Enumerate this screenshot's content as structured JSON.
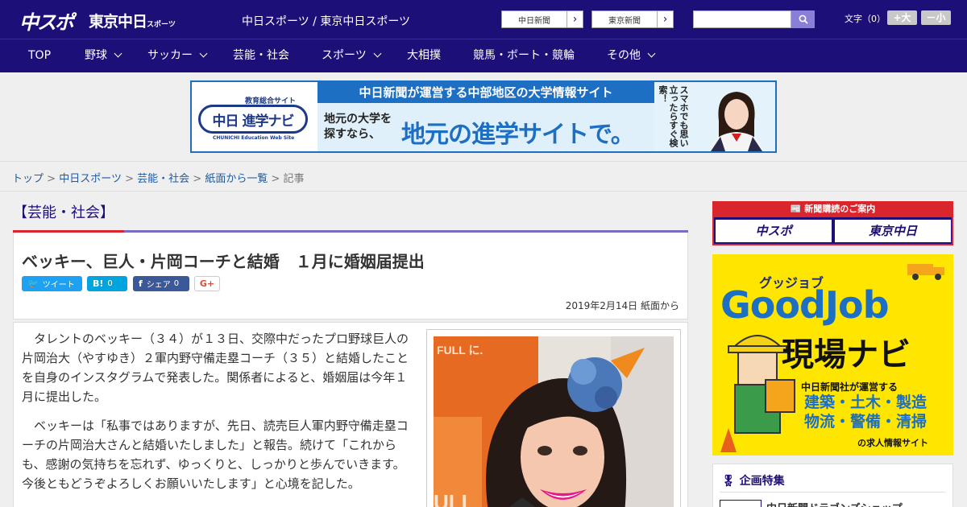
{
  "header": {
    "logo_chuspo": "中スポ",
    "logo_tokyo": "東京中日",
    "logo_tokyo_sub": "スポーツ",
    "brand_text": "中日スポーツ / 東京中日スポーツ",
    "link_chunichi": "中日新聞",
    "link_tokyo": "東京新聞",
    "search_placeholder": "",
    "fontsize_label": "文字（0）",
    "fontsize_plus": "+大",
    "fontsize_minus": "－小"
  },
  "nav": {
    "items": [
      {
        "label": "TOP"
      },
      {
        "label": "野球"
      },
      {
        "label": "サッカー"
      },
      {
        "label": "芸能・社会"
      },
      {
        "label": "スポーツ"
      },
      {
        "label": "大相撲"
      },
      {
        "label": "競馬・ボート・競輪"
      },
      {
        "label": "その他"
      }
    ]
  },
  "banner": {
    "left_sub": "教育総合サイト",
    "left_logo": "中日 進学ナビ",
    "left_en": "CHUNICHI Education Web Site",
    "top": "中日新聞が運営する中部地区の大学情報サイト",
    "mid_small_1": "地元の大学を",
    "mid_small_2": "探すなら、",
    "mid_big": "地元の進学サイトで。",
    "right_text": "スマホでも思い立ったらすぐ検索！"
  },
  "breadcrumb": {
    "items": [
      "トップ",
      "中日スポーツ",
      "芸能・社会",
      "紙面から一覧"
    ],
    "current": "記事",
    "separator": ">"
  },
  "article": {
    "category": "【芸能・社会】",
    "headline": "ベッキー、巨人・片岡コーチと結婚　１月に婚姻届提出",
    "share": {
      "tweet": "ツイート",
      "hatena_icon": "B!",
      "hatena_count": "0",
      "fb_label": "シェア",
      "fb_count": "0",
      "gplus": "G+"
    },
    "dateline": "2019年2月14日 紙面から",
    "paragraphs": [
      "タレントのベッキー（３４）が１３日、交際中だったプロ野球巨人の片岡治大（やすゆき）２軍内野守備走塁コーチ（３５）と結婚したことを自身のインスタグラムで発表した。関係者によると、婚姻届は今年１月に提出した。",
      "ベッキーは「私事ではありますが、先日、読売巨人軍内野守備走塁コーチの片岡治大さんと結婚いたしました」と報告。続けて「これからも、感謝の気持ちを忘れず、ゆっくりと、しっかりと歩んでいきます。今後ともどうぞよろしくお願いいたします」と心境を記した。"
    ],
    "photo_backdrop_text": "FULL に.",
    "photo_backdrop_text2": "ULL"
  },
  "sidebar": {
    "subscribe_title": "新聞購読のご案内",
    "subscribe_chuspo": "中スポ",
    "subscribe_tokyo": "東京中日",
    "goodjob_kana": "グッジョブ",
    "goodjob_main": "GoodJob",
    "goodjob_genba": "現場ナビ",
    "goodjob_desc": "中日新聞社が運営する",
    "goodjob_ind_1": "建築・土木・製造",
    "goodjob_ind_2": "物流・警備・清掃",
    "goodjob_site": "の求人情報サイト",
    "kikaku_title": "企画特集",
    "kikaku_item": "中日新聞ドラゴンズショップ"
  },
  "colors": {
    "brand_navy": "#1d0f78",
    "accent_red": "#d8262c",
    "link_blue": "#1f5aa0",
    "twitter": "#1da1f2",
    "hatena": "#00a4de",
    "facebook": "#3b5998"
  }
}
